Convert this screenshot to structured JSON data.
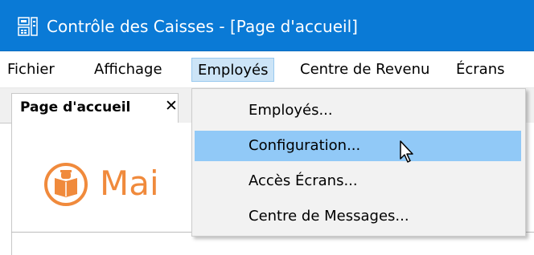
{
  "window": {
    "title": "Contrôle des Caisses - [Page d'accueil]",
    "colors": {
      "titlebar": "#0a7ad6",
      "accent": "#f08a3c",
      "menu_highlight": "#91c9f7"
    }
  },
  "menubar": {
    "items": [
      {
        "label": "Fichier"
      },
      {
        "label": "Affichage"
      },
      {
        "label": "Employés",
        "active": true
      },
      {
        "label": "Centre de Revenu"
      },
      {
        "label": "Écrans"
      }
    ]
  },
  "tabs": [
    {
      "label": "Page d'accueil",
      "close_icon": "close-icon"
    }
  ],
  "content": {
    "welcome_text": "Mai",
    "logo_icon": "book-reader-icon"
  },
  "dropdown": {
    "items": [
      {
        "label": "Employés..."
      },
      {
        "label": "Configuration...",
        "highlighted": true
      },
      {
        "label": "Accès Écrans..."
      },
      {
        "label": "Centre de Messages..."
      }
    ]
  }
}
